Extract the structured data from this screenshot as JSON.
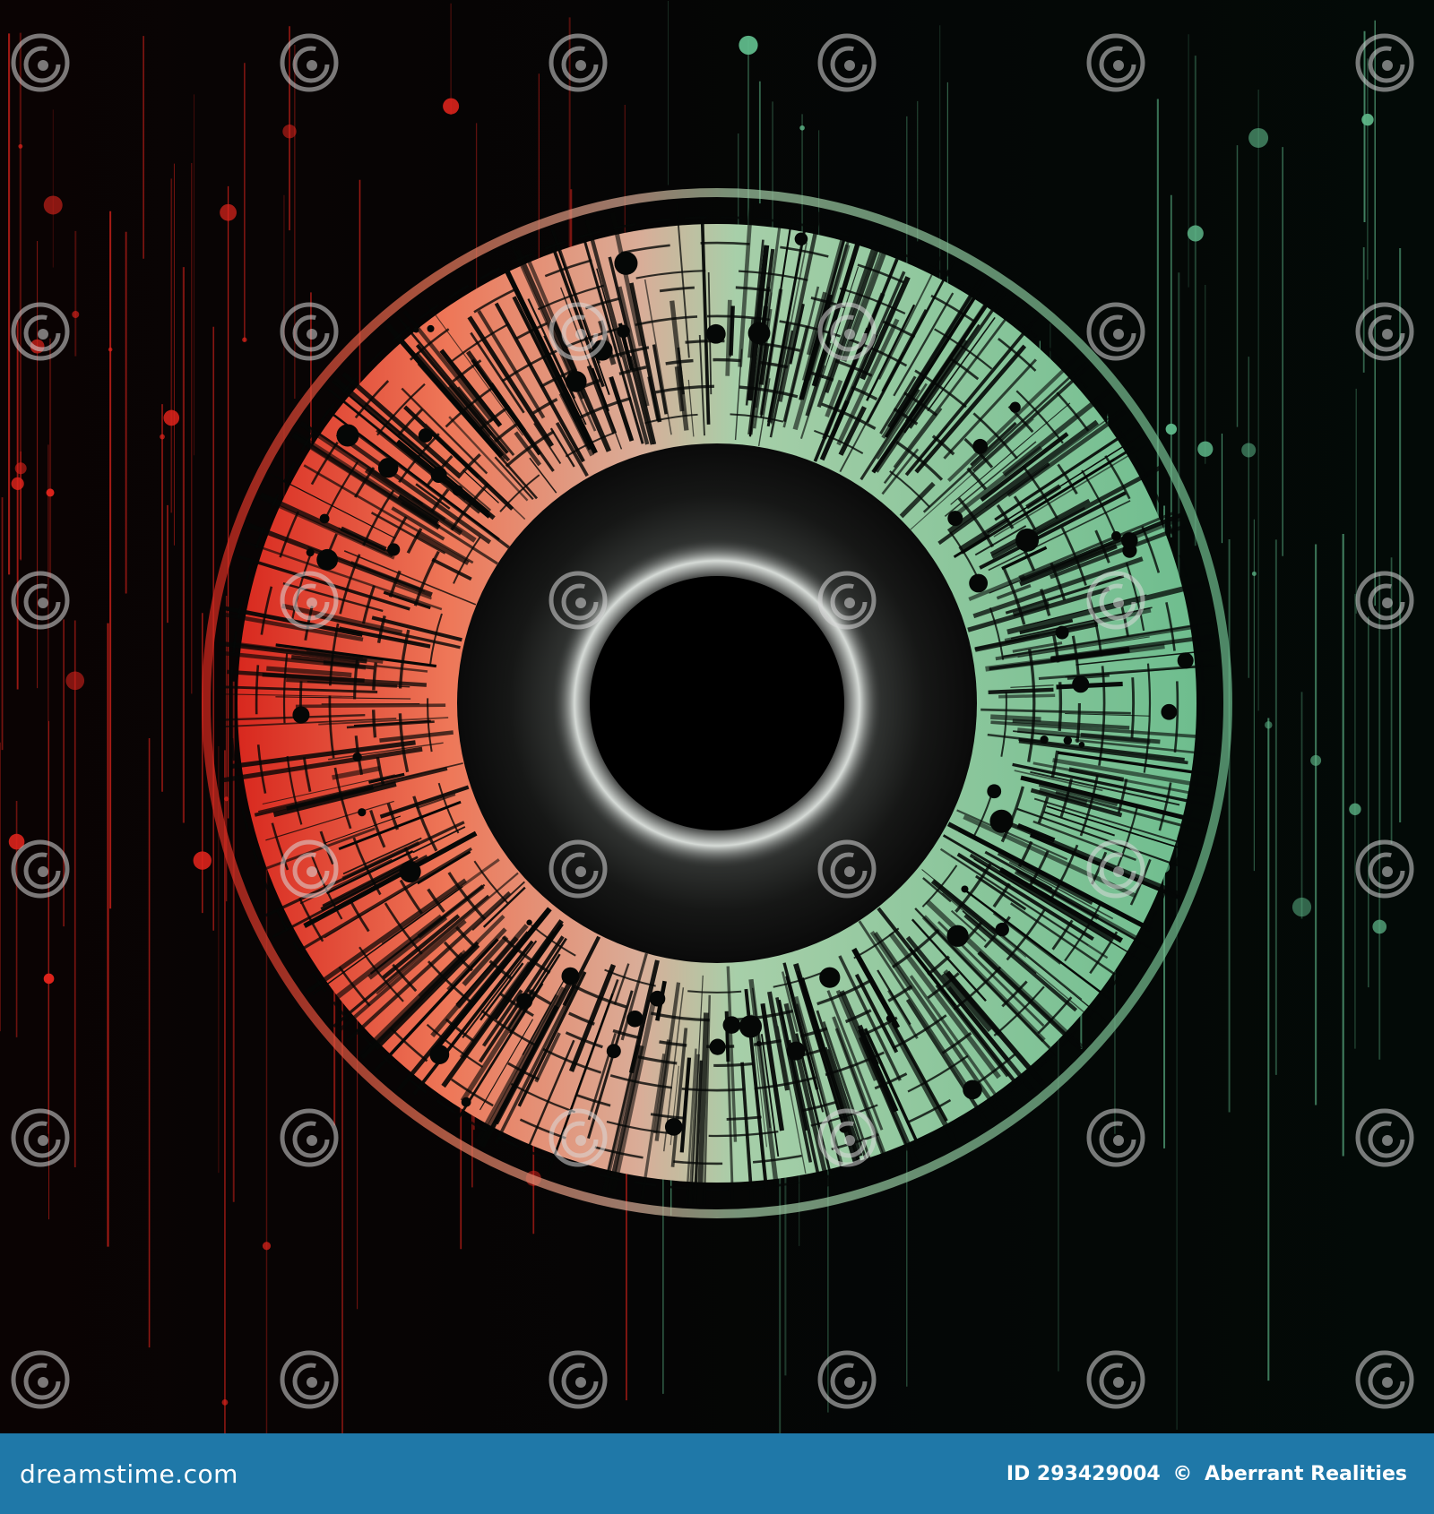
{
  "image": {
    "subject": "abstract digital eye",
    "colors": {
      "background": "#050706",
      "red_accent": "#e0241c",
      "red_iris": "#e86a52",
      "green_accent": "#5fb98a",
      "green_iris": "#9fd3ac",
      "pupil": "#000000",
      "footer_bar": "#1f78a8"
    }
  },
  "watermark": {
    "text": "dreamstime",
    "icon": "spiral-logo-icon"
  },
  "footer": {
    "brand": "dreamstime.com",
    "id_label": "ID 293429004",
    "copyright_symbol": "©",
    "author": "Aberrant Realities"
  }
}
